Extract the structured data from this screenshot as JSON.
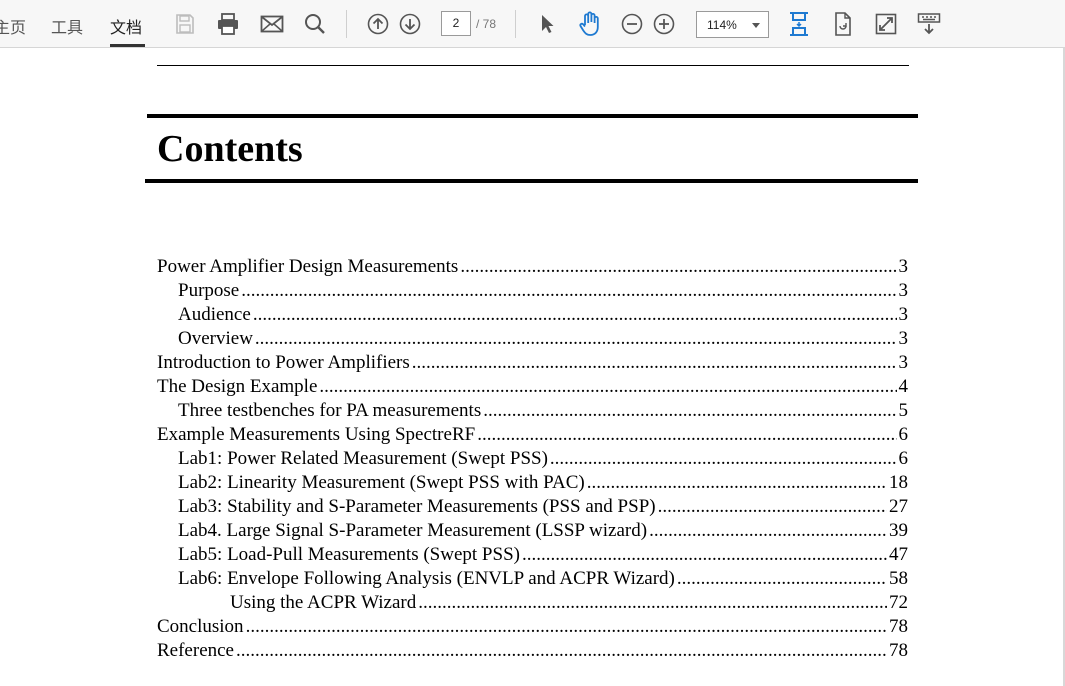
{
  "toolbar": {
    "tabs": [
      {
        "label": "主页"
      },
      {
        "label": "工具"
      },
      {
        "label": "文档"
      }
    ],
    "page_current": "2",
    "page_total": "/ 78",
    "zoom": "114%"
  },
  "document": {
    "heading": "Contents",
    "toc": [
      {
        "label": "Power Amplifier Design Measurements",
        "page": "3",
        "level": 0
      },
      {
        "label": "Purpose",
        "page": "3",
        "level": 1
      },
      {
        "label": "Audience",
        "page": "3",
        "level": 1
      },
      {
        "label": "Overview",
        "page": "3",
        "level": 1
      },
      {
        "label": "Introduction to Power Amplifiers",
        "page": "3",
        "level": 0
      },
      {
        "label": "The Design Example",
        "page": "4",
        "level": 0
      },
      {
        "label": "Three testbenches for PA measurements",
        "page": "5",
        "level": 1
      },
      {
        "label": "Example Measurements Using SpectreRF",
        "page": "6",
        "level": 0
      },
      {
        "label": "Lab1: Power Related Measurement (Swept PSS)",
        "page": "6",
        "level": 1
      },
      {
        "label": "Lab2: Linearity Measurement (Swept PSS with PAC)",
        "page": "18",
        "level": 1
      },
      {
        "label": "Lab3: Stability and S-Parameter Measurements (PSS and PSP)",
        "page": "27",
        "level": 1
      },
      {
        "label": "Lab4. Large Signal S-Parameter Measurement (LSSP wizard)",
        "page": "39",
        "level": 1
      },
      {
        "label": "Lab5: Load-Pull Measurements (Swept PSS)",
        "page": "47",
        "level": 1
      },
      {
        "label": "Lab6: Envelope Following Analysis (ENVLP and ACPR Wizard)",
        "page": "58",
        "level": 1
      },
      {
        "label": "Using the ACPR Wizard",
        "page": "72",
        "level": 2
      },
      {
        "label": "Conclusion",
        "page": "78",
        "level": 0
      },
      {
        "label": "Reference",
        "page": "78",
        "level": 0
      }
    ]
  }
}
